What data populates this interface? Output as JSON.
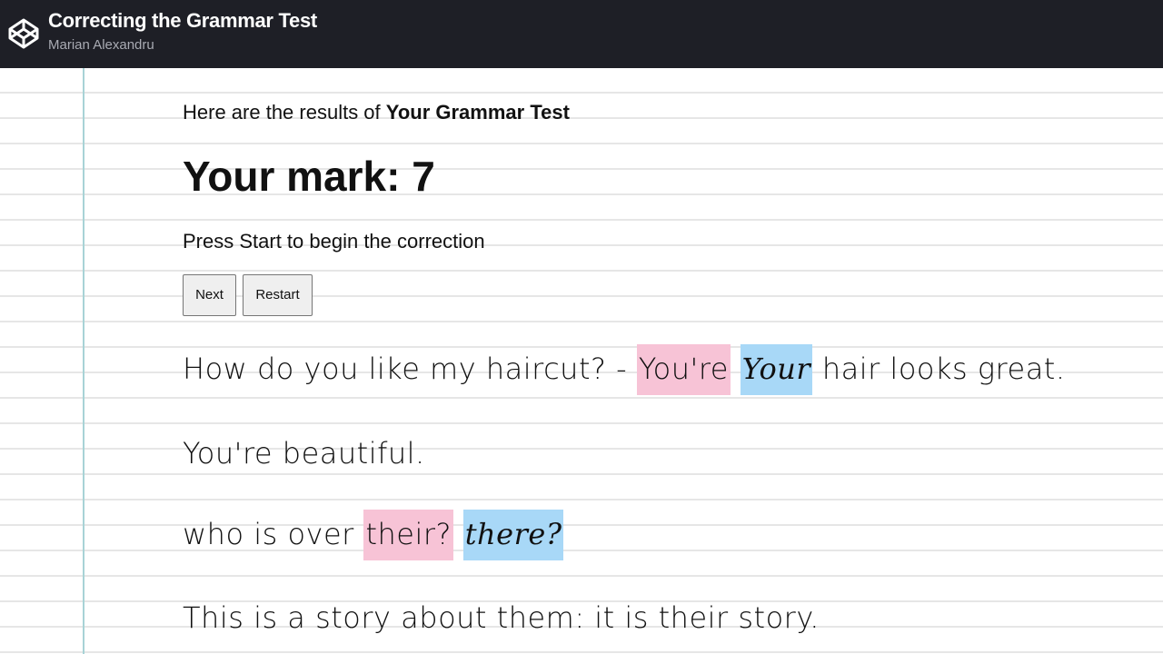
{
  "header": {
    "title": "Correcting the Grammar Test",
    "author": "Marian Alexandru",
    "logo_icon": "codepen-logo-icon"
  },
  "main": {
    "intro_prefix": "Here are the results of ",
    "intro_bold": "Your Grammar Test",
    "mark_label": "Your mark: ",
    "mark_value": "7",
    "hint": "Press Start to begin the correction",
    "buttons": {
      "next": "Next",
      "restart": "Restart"
    },
    "sentences": [
      {
        "before": "How do you like my haircut? - ",
        "wrong": "You're",
        "right": "Your",
        "after": " hair looks great."
      },
      {
        "text": "You're beautiful."
      },
      {
        "before": "who is over ",
        "wrong": "their?",
        "right": "there?",
        "after": ""
      },
      {
        "text": "This is a story about them: it is their story."
      }
    ]
  },
  "colors": {
    "header_bg": "#1e1f26",
    "wrong_highlight": "#f7c3d6",
    "right_highlight": "#a8d8f7",
    "margin_line": "#a8d3d6",
    "ruled_line": "#e6e6e6"
  }
}
